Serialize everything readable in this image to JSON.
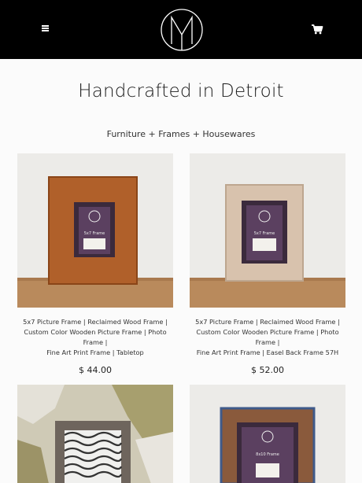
{
  "header": {
    "menu_icon": "hamburger-menu-icon",
    "logo_icon": "m-monogram-logo",
    "cart_icon": "shopping-cart-icon"
  },
  "page": {
    "title": "Handcrafted in Detroit",
    "subtitle": "Furniture + Frames + Housewares"
  },
  "products": [
    {
      "name_lines": [
        "5x7 Picture Frame | Reclaimed Wood Frame |",
        "Custom Color Wooden Picture Frame | Photo Frame |",
        "Fine Art Print Frame | Tabletop"
      ],
      "price": "$ 44.00",
      "insert_label": "5x7 Frame",
      "frame_color": "#b0602a"
    },
    {
      "name_lines": [
        "5x7 Picture Frame | Reclaimed Wood Frame |",
        "Custom Color Wooden Picture Frame | Photo Frame |",
        "Fine Art Print Frame | Easel Back Frame 57H"
      ],
      "price": "$ 52.00",
      "insert_label": "5x7 Frame",
      "frame_color": "#d8c2ad"
    },
    {
      "name_lines": [],
      "price": "",
      "insert_label": "",
      "frame_color": "#6e655d"
    },
    {
      "name_lines": [],
      "price": "",
      "insert_label": "8x10 Frame",
      "frame_color": "#8a5a3c"
    }
  ],
  "colors": {
    "header_bg": "#000000",
    "page_bg": "#fbfbfb",
    "text": "#222222"
  }
}
